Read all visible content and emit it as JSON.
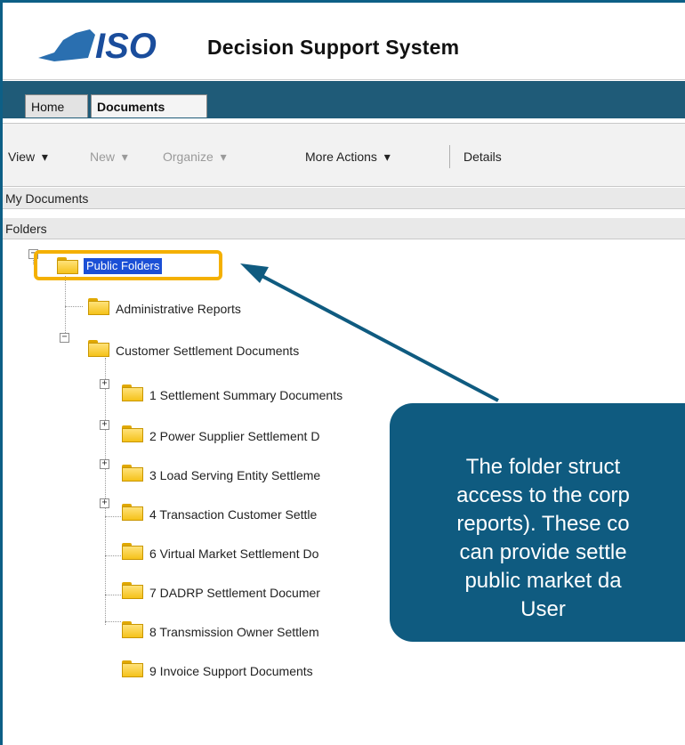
{
  "header": {
    "logo_text": "ISO",
    "app_title": "Decision Support System"
  },
  "tabs": [
    {
      "label": "Home",
      "active": false
    },
    {
      "label": "Documents",
      "active": true
    }
  ],
  "toolbar": {
    "view": "View",
    "new": "New",
    "organize": "Organize",
    "more_actions": "More Actions",
    "details": "Details"
  },
  "panels": {
    "my_documents": "My Documents",
    "folders": "Folders"
  },
  "tree": {
    "root": "Public Folders",
    "level1": [
      {
        "label": "Administrative Reports",
        "toggle": ""
      },
      {
        "label": "Customer Settlement Documents",
        "toggle": "−"
      }
    ],
    "level2": [
      {
        "label": "1 Settlement Summary Documents",
        "toggle": "+"
      },
      {
        "label": "2 Power Supplier Settlement D",
        "toggle": "+"
      },
      {
        "label": "3 Load Serving Entity Settleme",
        "toggle": "+"
      },
      {
        "label": "4 Transaction Customer Settle",
        "toggle": "+"
      },
      {
        "label": "6 Virtual Market Settlement Do",
        "toggle": ""
      },
      {
        "label": "7 DADRP Settlement Documer",
        "toggle": ""
      },
      {
        "label": "8 Transmission Owner Settlem",
        "toggle": ""
      },
      {
        "label": "9 Invoice Support Documents",
        "toggle": ""
      }
    ]
  },
  "callout": {
    "lines": [
      "The folder struct",
      "access to the corp",
      "reports). These co",
      "can provide settle",
      "public market da",
      "User"
    ]
  },
  "colors": {
    "brand_blue": "#0f5b80",
    "tab_bar": "#1f5b78",
    "highlight": "#f4b000",
    "selection": "#1b4fd6"
  }
}
